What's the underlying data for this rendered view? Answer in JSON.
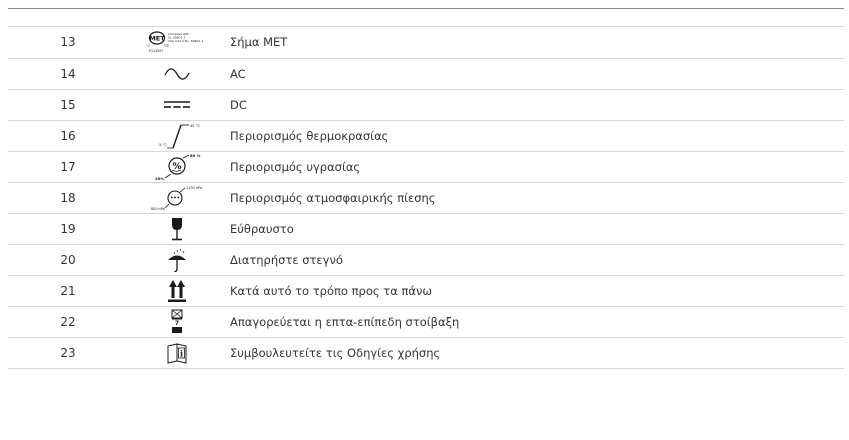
{
  "table": {
    "rows": [
      {
        "number": "13",
        "icon": "met-mark-icon",
        "description": "Σήμα MET",
        "icon_text": {
          "logo": "MET",
          "c": "C",
          "us": "US",
          "file_no": "E114597",
          "comply_1": "Complies with",
          "comply_2": "UL 60601-1",
          "comply_3": "CSA C22.2 No. 60601-1"
        }
      },
      {
        "number": "14",
        "icon": "ac-icon",
        "description": "AC"
      },
      {
        "number": "15",
        "icon": "dc-icon",
        "description": "DC"
      },
      {
        "number": "16",
        "icon": "temperature-limit-icon",
        "description": "Περιορισμός θερμοκρασίας",
        "icon_text": {
          "upper": "45 °C",
          "lower": "-5 °C"
        }
      },
      {
        "number": "17",
        "icon": "humidity-limit-icon",
        "description": "Περιορισμός υγρασίας",
        "icon_text": {
          "symbol": "%",
          "upper": "80 %",
          "lower": "20%"
        }
      },
      {
        "number": "18",
        "icon": "pressure-limit-icon",
        "description": "Περιορισμός ατμοσφαιρικής πίεσης",
        "icon_text": {
          "symbol": "•••",
          "upper": "1100 hPa",
          "lower": "800 hPa"
        }
      },
      {
        "number": "19",
        "icon": "fragile-icon",
        "description": "Εύθραυστο"
      },
      {
        "number": "20",
        "icon": "keep-dry-icon",
        "description": "Διατηρήστε στεγνό"
      },
      {
        "number": "21",
        "icon": "this-way-up-icon",
        "description": "Κατά αυτό το τρόπο προς τα πάνω"
      },
      {
        "number": "22",
        "icon": "stacking-limit-icon",
        "description": "Απαγορεύεται η επτα-επίπεδη στοίβαξη",
        "icon_text": {
          "count": "7"
        }
      },
      {
        "number": "23",
        "icon": "consult-instructions-icon",
        "description": "Συμβουλευτείτε τις Οδηγίες χρήσης",
        "icon_text": {
          "symbol": "i"
        }
      }
    ]
  },
  "colors": {
    "text": "#333333",
    "icon": "#1a1a1a",
    "rule": "#d6d6d6",
    "top_rule": "#8a8a8a"
  }
}
